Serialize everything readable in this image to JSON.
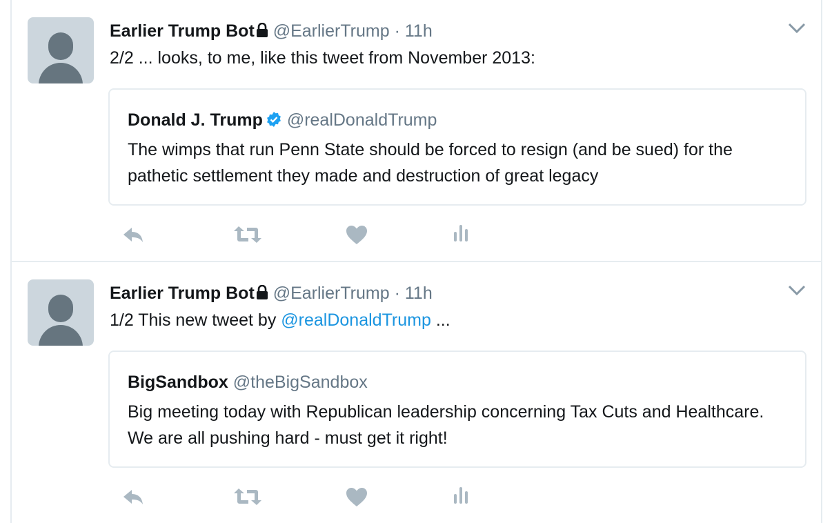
{
  "tweets": [
    {
      "author_name": "Earlier Trump Bot",
      "handle": "@EarlierTrump",
      "separator": "·",
      "time": "11h",
      "text_before": "2/2 ... looks, to me, like this tweet from November 2013:",
      "mention": "",
      "text_after": "",
      "quoted": {
        "author_name": "Donald J. Trump",
        "verified": true,
        "handle": "@realDonaldTrump",
        "text": "The wimps that run Penn State should be forced to resign (and be sued) for the pathetic settlement they made and destruction of great legacy"
      }
    },
    {
      "author_name": "Earlier Trump Bot",
      "handle": "@EarlierTrump",
      "separator": "·",
      "time": "11h",
      "text_before": "1/2 This new tweet by ",
      "mention": "@realDonaldTrump",
      "text_after": " ...",
      "quoted": {
        "author_name": "BigSandbox",
        "verified": false,
        "handle": "@theBigSandbox",
        "text": "Big meeting today with Republican leadership concerning Tax Cuts and Healthcare. We are all pushing hard - must get it right!"
      }
    }
  ],
  "icons": {
    "protected": "lock-icon",
    "verified": "verified-badge-icon",
    "menu": "chevron-down-icon",
    "reply": "reply-icon",
    "retweet": "retweet-icon",
    "like": "heart-icon",
    "analytics": "analytics-icon"
  },
  "colors": {
    "link": "#1b95e0",
    "secondary_text": "#657786",
    "action_icon": "#aab8c2",
    "verified": "#1da1f2",
    "border": "#e6ecf0"
  }
}
